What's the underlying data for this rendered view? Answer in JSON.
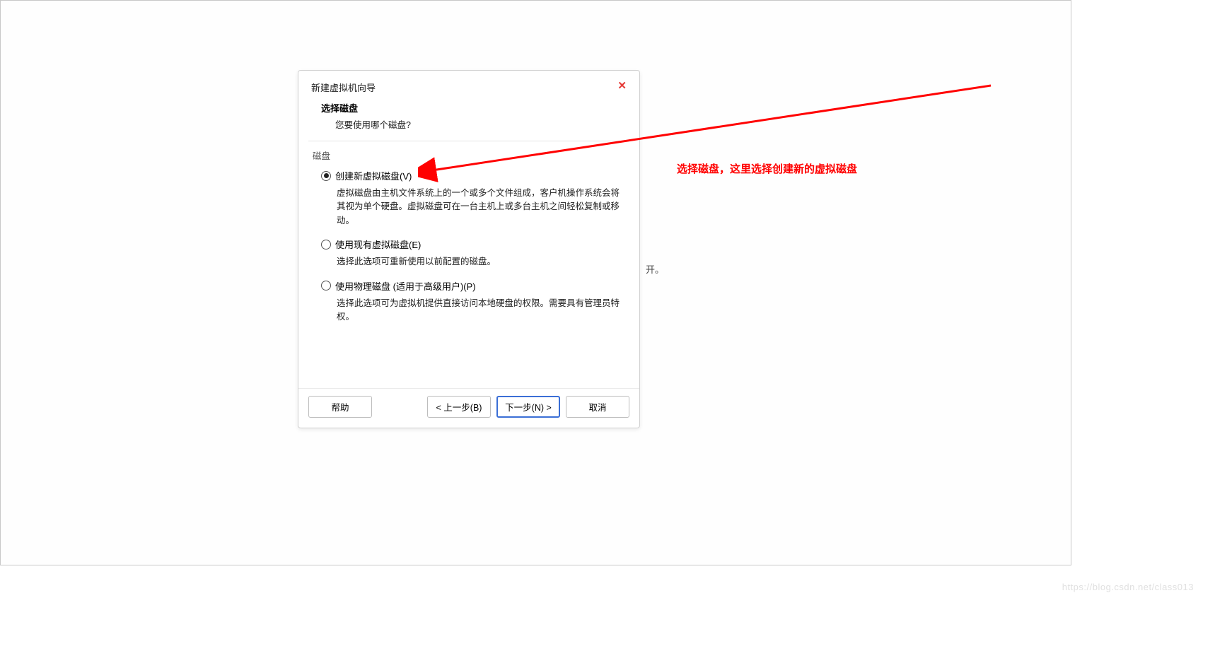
{
  "dialog": {
    "title": "新建虚拟机向导",
    "subtitle": "选择磁盘",
    "subtitle_desc": "您要使用哪个磁盘?",
    "group_label": "磁盘",
    "options": [
      {
        "label": "创建新虚拟磁盘(V)",
        "desc": "虚拟磁盘由主机文件系统上的一个或多个文件组成，客户机操作系统会将其视为单个硬盘。虚拟磁盘可在一台主机上或多台主机之间轻松复制或移动。"
      },
      {
        "label": "使用现有虚拟磁盘(E)",
        "desc": "选择此选项可重新使用以前配置的磁盘。"
      },
      {
        "label": "使用物理磁盘 (适用于高级用户)(P)",
        "desc": "选择此选项可为虚拟机提供直接访问本地硬盘的权限。需要具有管理员特权。"
      }
    ],
    "buttons": {
      "help": "帮助",
      "back": "< 上一步(B)",
      "next": "下一步(N) >",
      "cancel": "取消"
    }
  },
  "annotation": "选择磁盘，这里选择创建新的虚拟磁盘",
  "background_hint": "开。",
  "watermark": "https://blog.csdn.net/class013",
  "colors": {
    "accent_red": "#ff0000",
    "close_red": "#e53935",
    "focus_blue": "#3b6fd6"
  }
}
